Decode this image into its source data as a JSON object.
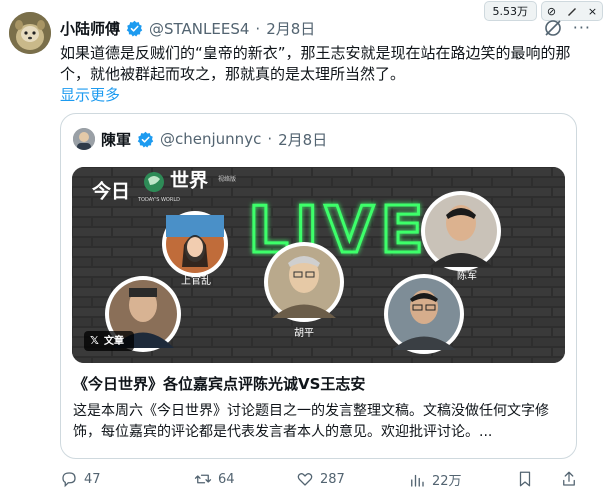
{
  "top_bar": {
    "view_count_badge": "5.53万"
  },
  "tweet": {
    "author_name": "小陆师傅",
    "handle": "@STANLEES4",
    "separator": "·",
    "date": "2月8日",
    "text": "如果道德是反贼们的“皇帝的新衣”，那王志安就是现在站在路边笑的最响的那个，就他被群起而攻之，那就真的是太理所当然了。",
    "show_more": "显示更多"
  },
  "quote": {
    "author_name": "陳軍",
    "handle": "@chenjunnyc",
    "separator": "·",
    "date": "2月8日",
    "media": {
      "show_title": "今日",
      "show_title_2": "世界",
      "show_subtitle": "TODAY'S WORLD",
      "show_tag": "视络版",
      "live_text": "LIVE",
      "guests": [
        "上官乱",
        "胡平",
        "陈军"
      ],
      "badge_text": "文章"
    },
    "title": "《今日世界》各位嘉宾点评陈光诚VS王志安",
    "description": "这是本周六《今日世界》讨论题目之一的发言整理文稿。文稿没做任何文字修饰，每位嘉宾的评论都是代表发言者本人的意见。欢迎批评讨论。..."
  },
  "actions": {
    "replies": "47",
    "retweets": "64",
    "likes": "287",
    "views": "22万"
  },
  "colors": {
    "accent": "#1d9bf0",
    "text": "#0f1419",
    "muted": "#536471",
    "border": "#cfd9de",
    "live_neon": "#3dff6a"
  }
}
